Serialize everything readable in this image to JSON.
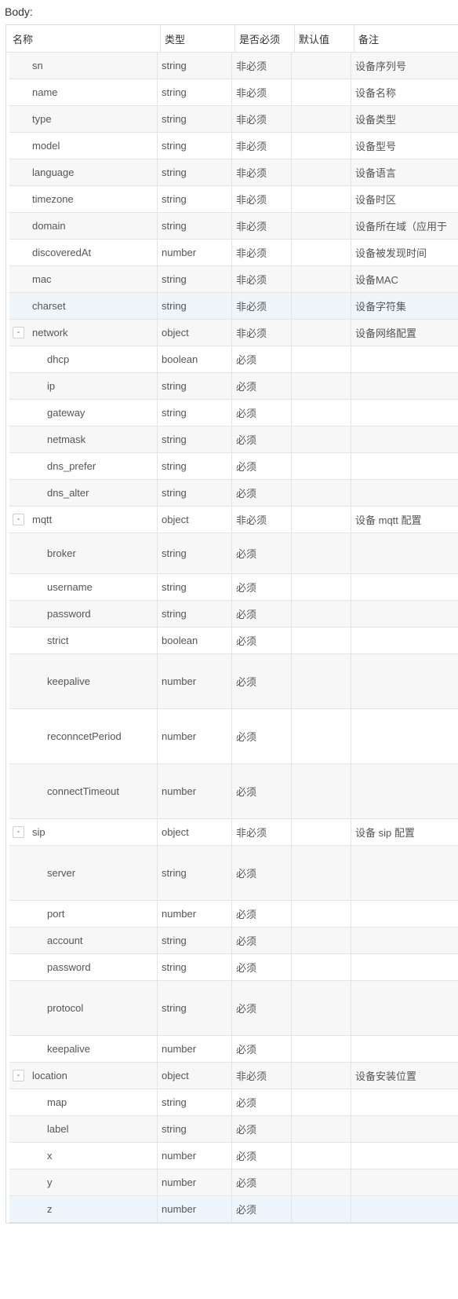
{
  "title": "Body:",
  "columns": {
    "name": "名称",
    "type": "类型",
    "required": "是否必须",
    "default": "默认值",
    "note": "备注"
  },
  "rows": [
    {
      "name": "sn",
      "type": "string",
      "required": "非必须",
      "default": "",
      "note": "设备序列号",
      "level": 0
    },
    {
      "name": "name",
      "type": "string",
      "required": "非必须",
      "default": "",
      "note": "设备名称",
      "level": 0
    },
    {
      "name": "type",
      "type": "string",
      "required": "非必须",
      "default": "",
      "note": "设备类型",
      "level": 0
    },
    {
      "name": "model",
      "type": "string",
      "required": "非必须",
      "default": "",
      "note": "设备型号",
      "level": 0
    },
    {
      "name": "language",
      "type": "string",
      "required": "非必须",
      "default": "",
      "note": "设备语言",
      "level": 0
    },
    {
      "name": "timezone",
      "type": "string",
      "required": "非必须",
      "default": "",
      "note": "设备时区",
      "level": 0
    },
    {
      "name": "domain",
      "type": "string",
      "required": "非必须",
      "default": "",
      "note": "设备所在域（应用于",
      "level": 0
    },
    {
      "name": "discoveredAt",
      "type": "number",
      "required": "非必须",
      "default": "",
      "note": "设备被发现时间",
      "level": 0
    },
    {
      "name": "mac",
      "type": "string",
      "required": "非必须",
      "default": "",
      "note": "设备MAC",
      "level": 0
    },
    {
      "name": "charset",
      "type": "string",
      "required": "非必须",
      "default": "",
      "note": "设备字符集",
      "level": 0,
      "highlight": true
    },
    {
      "name": "network",
      "type": "object",
      "required": "非必须",
      "default": "",
      "note": "设备网络配置",
      "level": 0,
      "toggle": "-"
    },
    {
      "name": "dhcp",
      "type": "boolean",
      "required": "必须",
      "default": "",
      "note": "",
      "level": 1
    },
    {
      "name": "ip",
      "type": "string",
      "required": "必须",
      "default": "",
      "note": "",
      "level": 1
    },
    {
      "name": "gateway",
      "type": "string",
      "required": "必须",
      "default": "",
      "note": "",
      "level": 1
    },
    {
      "name": "netmask",
      "type": "string",
      "required": "必须",
      "default": "",
      "note": "",
      "level": 1
    },
    {
      "name": "dns_prefer",
      "type": "string",
      "required": "必须",
      "default": "",
      "note": "",
      "level": 1
    },
    {
      "name": "dns_alter",
      "type": "string",
      "required": "必须",
      "default": "",
      "note": "",
      "level": 1
    },
    {
      "name": "mqtt",
      "type": "object",
      "required": "非必须",
      "default": "",
      "note": "设备 mqtt 配置",
      "level": 0,
      "toggle": "-"
    },
    {
      "name": "broker",
      "type": "string",
      "required": "必须",
      "default": "",
      "note": "",
      "level": 1
    },
    {
      "name": "username",
      "type": "string",
      "required": "必须",
      "default": "",
      "note": "",
      "level": 1
    },
    {
      "name": "password",
      "type": "string",
      "required": "必须",
      "default": "",
      "note": "",
      "level": 1
    },
    {
      "name": "strict",
      "type": "boolean",
      "required": "必须",
      "default": "",
      "note": "",
      "level": 1
    },
    {
      "name": "keepalive",
      "type": "number",
      "required": "必须",
      "default": "",
      "note": "",
      "level": 1
    },
    {
      "name": "reconncetPeriod",
      "type": "number",
      "required": "必须",
      "default": "",
      "note": "",
      "level": 1
    },
    {
      "name": "connectTimeout",
      "type": "number",
      "required": "必须",
      "default": "",
      "note": "",
      "level": 1
    },
    {
      "name": "sip",
      "type": "object",
      "required": "非必须",
      "default": "",
      "note": "设备 sip 配置",
      "level": 0,
      "toggle": "-"
    },
    {
      "name": "server",
      "type": "string",
      "required": "必须",
      "default": "",
      "note": "",
      "level": 1
    },
    {
      "name": "port",
      "type": "number",
      "required": "必须",
      "default": "",
      "note": "",
      "level": 1
    },
    {
      "name": "account",
      "type": "string",
      "required": "必须",
      "default": "",
      "note": "",
      "level": 1
    },
    {
      "name": "password",
      "type": "string",
      "required": "必须",
      "default": "",
      "note": "",
      "level": 1
    },
    {
      "name": "protocol",
      "type": "string",
      "required": "必须",
      "default": "",
      "note": "",
      "level": 1
    },
    {
      "name": "keepalive",
      "type": "number",
      "required": "必须",
      "default": "",
      "note": "",
      "level": 1
    },
    {
      "name": "location",
      "type": "object",
      "required": "非必须",
      "default": "",
      "note": "设备安装位置",
      "level": 0,
      "toggle": "-"
    },
    {
      "name": "map",
      "type": "string",
      "required": "必须",
      "default": "",
      "note": "",
      "level": 1
    },
    {
      "name": "label",
      "type": "string",
      "required": "必须",
      "default": "",
      "note": "",
      "level": 1
    },
    {
      "name": "x",
      "type": "number",
      "required": "必须",
      "default": "",
      "note": "",
      "level": 1
    },
    {
      "name": "y",
      "type": "number",
      "required": "必须",
      "default": "",
      "note": "",
      "level": 1
    },
    {
      "name": "z",
      "type": "number",
      "required": "必须",
      "default": "",
      "note": "",
      "level": 1,
      "highlight": true
    }
  ]
}
